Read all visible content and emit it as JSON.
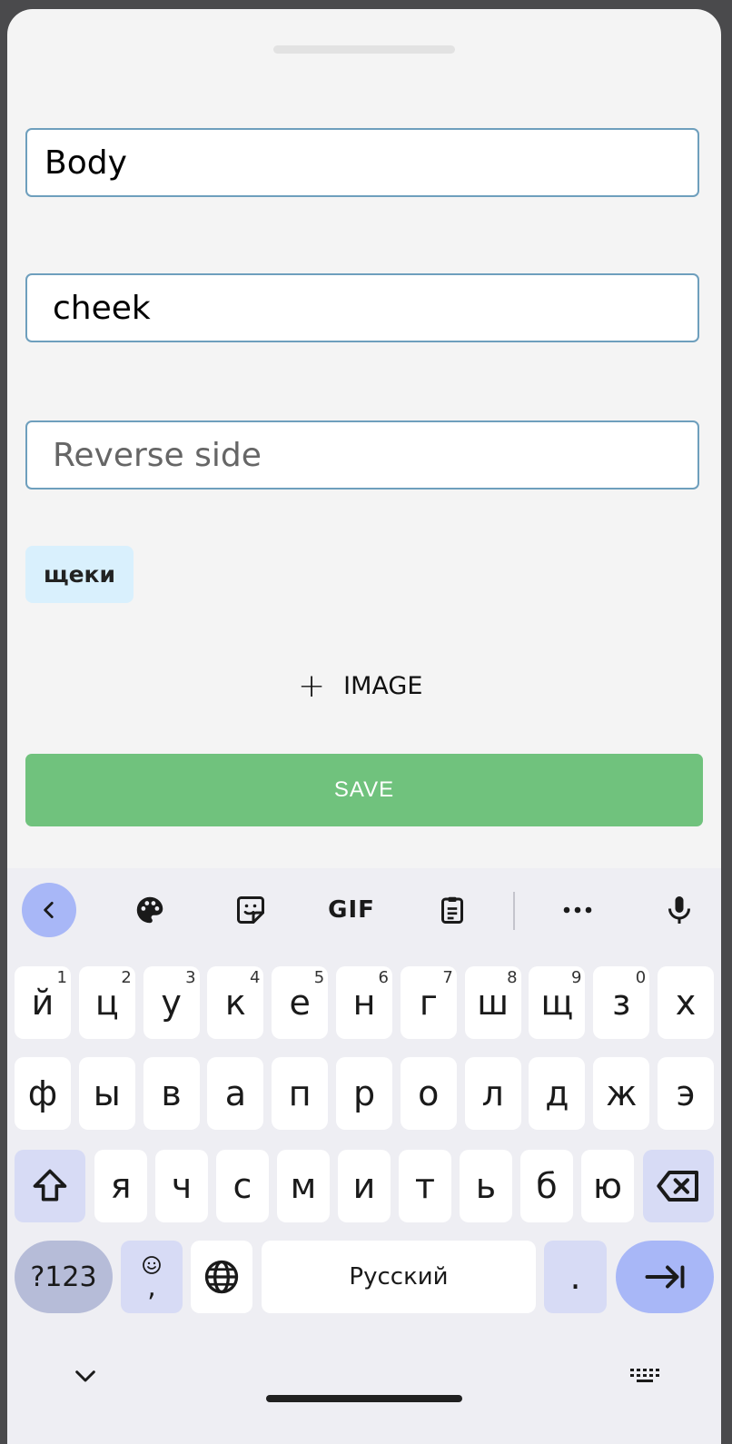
{
  "form": {
    "category_value": "Body",
    "front_value": "cheek",
    "reverse_placeholder": "Reverse side",
    "suggestion_chip": "щеки",
    "image_button_label": "IMAGE",
    "save_label": "SAVE"
  },
  "keyboard": {
    "toolbar_icons": [
      "chevron-left-icon",
      "palette-icon",
      "sticker-icon",
      "gif-icon",
      "clipboard-icon",
      "more-icon",
      "microphone-icon"
    ],
    "toolbar_gif": "GIF",
    "row1": [
      {
        "k": "й",
        "s": "1"
      },
      {
        "k": "ц",
        "s": "2"
      },
      {
        "k": "у",
        "s": "3"
      },
      {
        "k": "к",
        "s": "4"
      },
      {
        "k": "е",
        "s": "5"
      },
      {
        "k": "н",
        "s": "6"
      },
      {
        "k": "г",
        "s": "7"
      },
      {
        "k": "ш",
        "s": "8"
      },
      {
        "k": "щ",
        "s": "9"
      },
      {
        "k": "з",
        "s": "0"
      },
      {
        "k": "х",
        "s": ""
      }
    ],
    "row2": [
      "ф",
      "ы",
      "в",
      "а",
      "п",
      "р",
      "о",
      "л",
      "д",
      "ж",
      "э"
    ],
    "row3": [
      "я",
      "ч",
      "с",
      "м",
      "и",
      "т",
      "ь",
      "б",
      "ю"
    ],
    "sym_label": "?123",
    "emoji_comma": ",",
    "space_label": "Русский",
    "period_label": "."
  },
  "colors": {
    "save_button": "#70c27d",
    "field_border": "#6e9fbd",
    "chip_bg": "#d9f0fd",
    "keyboard_accent": "#a8b7f7"
  }
}
